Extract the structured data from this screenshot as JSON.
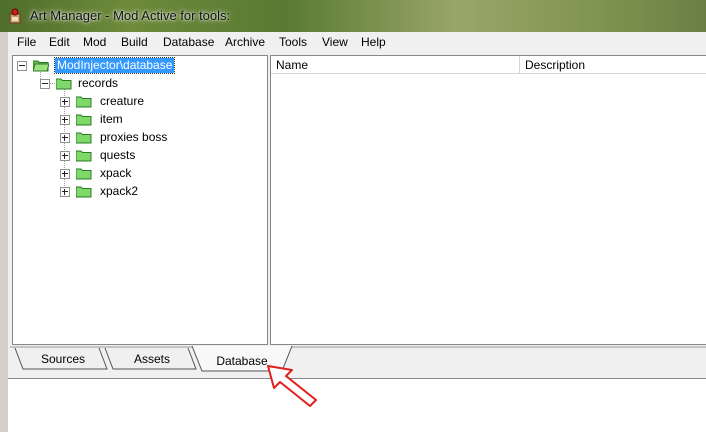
{
  "window": {
    "title": "Art Manager - Mod Active for tools:"
  },
  "menu": [
    "File",
    "Edit",
    "Mod",
    "Build",
    "Database",
    "Archive",
    "Tools",
    "View",
    "Help"
  ],
  "tree": {
    "root": "ModInjector\\database",
    "records": "records",
    "children": [
      "creature",
      "item",
      "proxies boss",
      "quests",
      "xpack",
      "xpack2"
    ]
  },
  "list": {
    "columns": [
      "Name",
      "Description"
    ]
  },
  "tabs": [
    "Sources",
    "Assets",
    "Database"
  ],
  "colors": {
    "selection": "#3399ff",
    "folder_green": "#7fd86a",
    "arrow": "#e02020"
  },
  "icons": {
    "app": "art-manager-app-icon",
    "folder": "folder-icon",
    "arrow": "arrow-annotation-icon"
  }
}
